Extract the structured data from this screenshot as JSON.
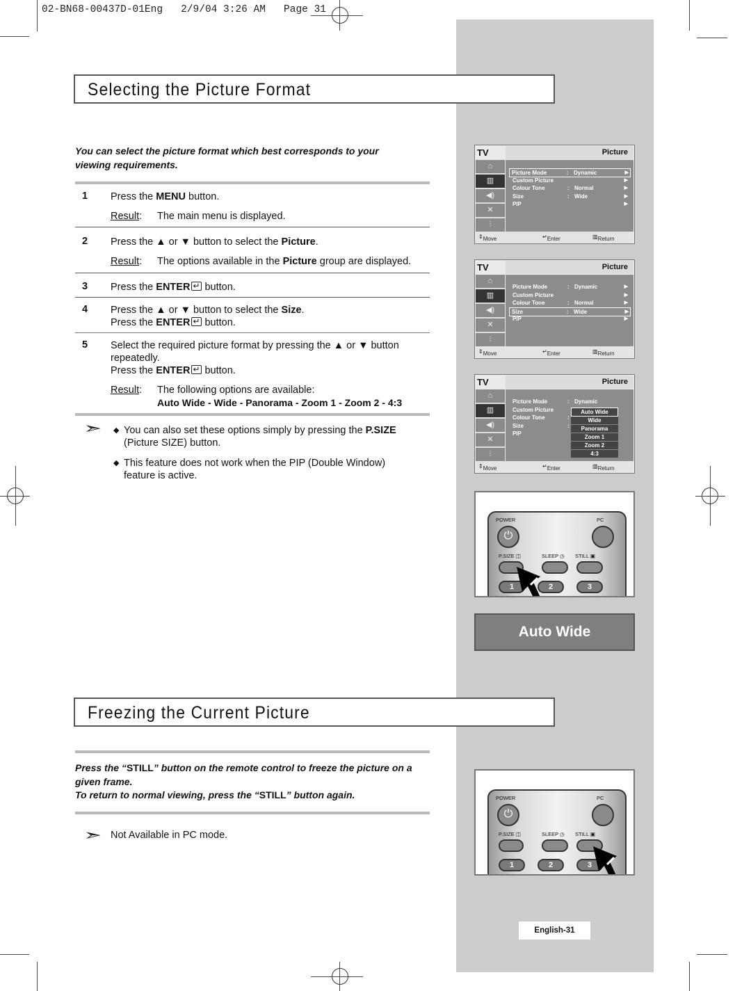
{
  "slug": "02-BN68-00437D-01Eng   2/9/04 3:26 AM   Page 31",
  "section1": {
    "title": "Selecting the Picture Format",
    "intro": "You can select the picture format which best corresponds to your viewing requirements.",
    "steps": [
      {
        "num": "1",
        "pre": "Press the ",
        "bold": "MENU",
        "post": " button.",
        "result_label": "Result",
        "result": "The main menu is displayed."
      },
      {
        "num": "2",
        "pre": "Press the ▲ or ▼ button to select the ",
        "bold": "Picture",
        "post": ".",
        "result_label": "Result",
        "result_pre": "The options available in the ",
        "result_bold": "Picture",
        "result_post": " group are displayed."
      },
      {
        "num": "3",
        "pre": "Press the ",
        "bold": "ENTER",
        "post": " button."
      },
      {
        "num": "4",
        "pre": "Press the ▲ or ▼ button to select the ",
        "bold": "Size",
        "post": ".",
        "line2_pre": "Press the ",
        "line2_bold": "ENTER",
        "line2_post": " button."
      },
      {
        "num": "5",
        "pre": "Select the required picture format by pressing the ▲ or ▼ button repeatedly.",
        "line2_pre": "Press the ",
        "line2_bold": "ENTER",
        "line2_post": " button.",
        "result_label": "Result",
        "result": "The following options are available:",
        "result_options": "Auto Wide - Wide - Panorama - Zoom 1 - Zoom 2 - 4:3"
      }
    ],
    "notes": [
      {
        "pre": "You can also set these options simply by pressing the ",
        "bold": "P.SIZE",
        "post": " (Picture SIZE) button."
      },
      {
        "text": "This feature does not work when the PIP (Double Window) feature is active."
      }
    ]
  },
  "osd": {
    "tv_label": "TV",
    "header": "Picture",
    "sidebar_icons": [
      "input-icon",
      "picture-icon",
      "sound-icon",
      "channel-icon",
      "setup-icon"
    ],
    "rows": [
      {
        "label": "Picture Mode",
        "value": "Dynamic"
      },
      {
        "label": "Custom Picture",
        "value": ""
      },
      {
        "label": "Colour Tone",
        "value": "Normal"
      },
      {
        "label": "Size",
        "value": "Wide"
      },
      {
        "label": "PIP",
        "value": ""
      }
    ],
    "footer": {
      "move": "Move",
      "enter": "Enter",
      "return": "Return"
    },
    "screens": [
      {
        "highlighted_row": "Picture Mode"
      },
      {
        "highlighted_row": "Size"
      },
      {
        "size_options": [
          "Auto Wide",
          "Wide",
          "Panorama",
          "Zoom 1",
          "Zoom 2",
          "4:3"
        ],
        "selected_option": "Auto Wide"
      }
    ]
  },
  "remote": {
    "power": "POWER",
    "pc": "PC",
    "psize": "P.SIZE",
    "sleep": "SLEEP",
    "still": "STILL",
    "nums": [
      "1",
      "2",
      "3"
    ]
  },
  "autowide_caption": "Auto Wide",
  "section2": {
    "title": "Freezing the Current Picture",
    "intro1_pre": "Press the “",
    "intro1_bold": "STILL",
    "intro1_post": "” button on the remote control to freeze the picture on a given frame.",
    "intro2_pre": "To return to normal viewing, press the “",
    "intro2_bold": "STILL",
    "intro2_post": "” button again.",
    "note": "Not Available in PC mode."
  },
  "page_label": "English-31"
}
